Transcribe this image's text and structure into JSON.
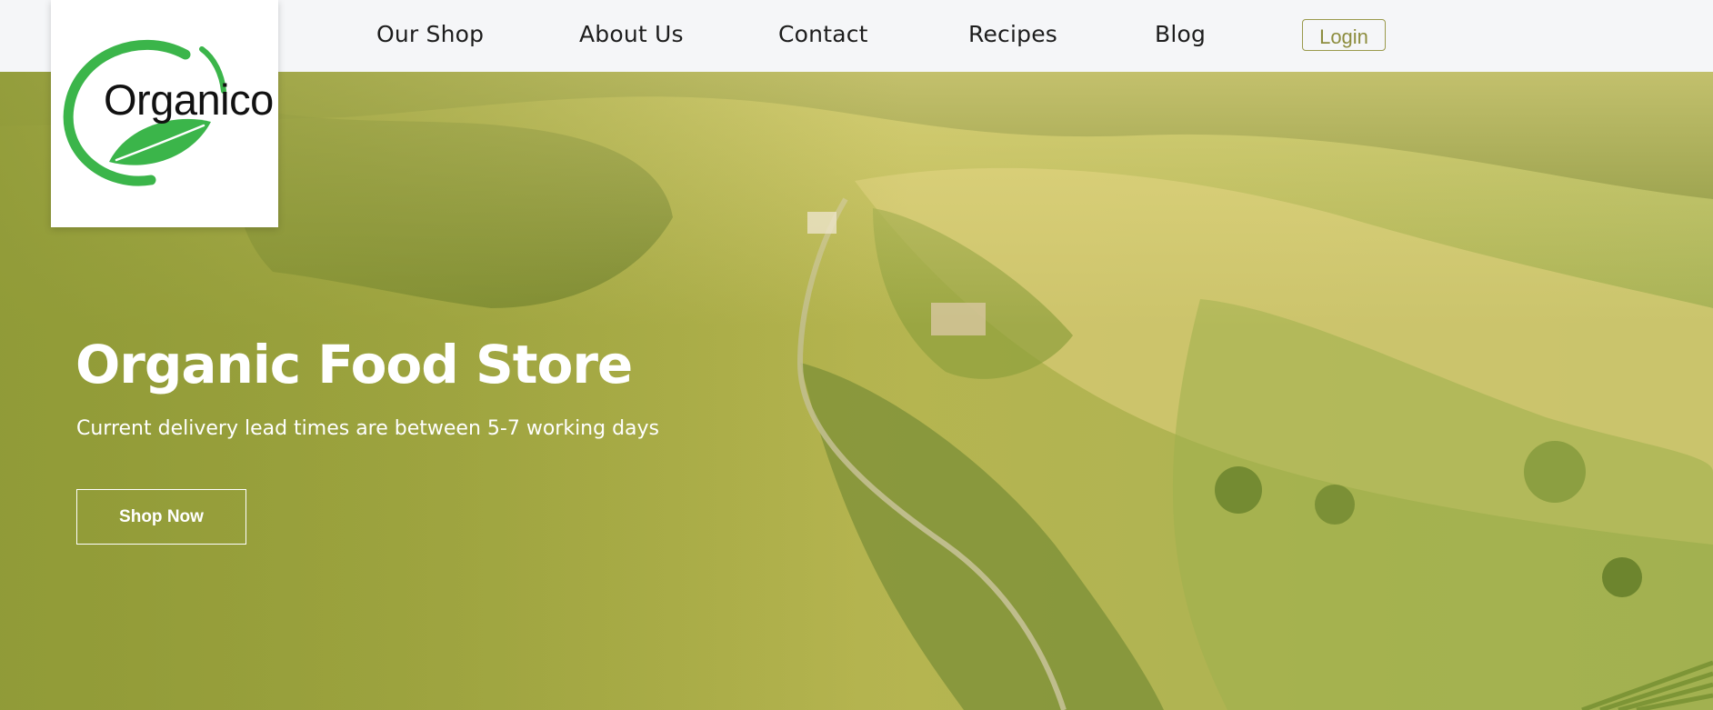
{
  "brand": {
    "name": "Organico",
    "colors": {
      "accent": "#3bb54a",
      "olive": "#9a9a4c",
      "hero_overlay": "#a3a745"
    }
  },
  "nav": {
    "items": [
      {
        "label": "Our Shop"
      },
      {
        "label": "About Us"
      },
      {
        "label": "Contact"
      },
      {
        "label": "Recipes"
      },
      {
        "label": "Blog"
      }
    ],
    "login_label": "Login"
  },
  "hero": {
    "title": "Organic Food Store",
    "subtitle": "Current delivery lead times are between 5-7 working days",
    "cta_label": "Shop Now"
  }
}
